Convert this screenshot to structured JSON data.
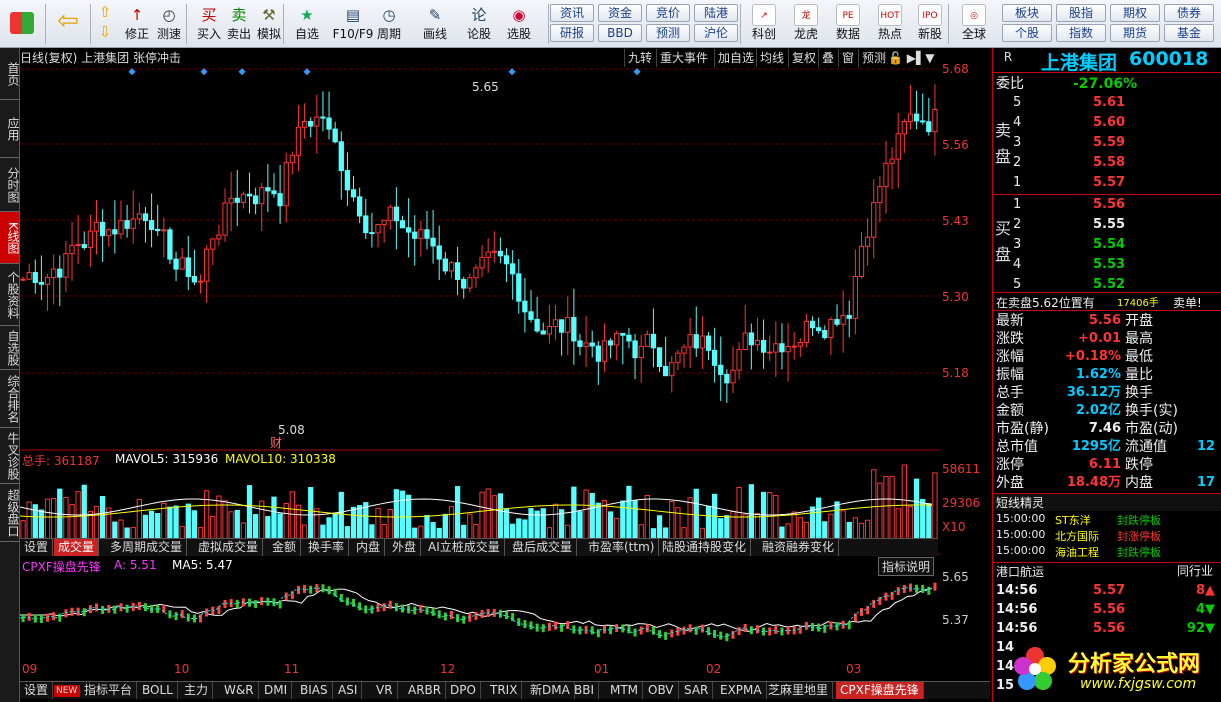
{
  "toolbar": {
    "row_buttons": [
      {
        "label": "修正",
        "icon": "↑"
      },
      {
        "label": "测速",
        "icon": "◴"
      },
      {
        "label": "买入",
        "icon": "买"
      },
      {
        "label": "卖出",
        "icon": "卖"
      },
      {
        "label": "模拟",
        "icon": "⚒"
      },
      {
        "label": "自选",
        "icon": "★"
      },
      {
        "label": "F10/F9",
        "icon": "▤"
      },
      {
        "label": "周期",
        "icon": "◷"
      },
      {
        "label": "画线",
        "icon": "✎"
      },
      {
        "label": "论股",
        "icon": "论"
      },
      {
        "label": "选股",
        "icon": "◉"
      }
    ],
    "grid1": [
      "资讯",
      "资金",
      "竞价",
      "陆港",
      "研报",
      "BBD",
      "预测",
      "沪伦"
    ],
    "mid_buttons": [
      {
        "label": "科创",
        "icon": "↗"
      },
      {
        "label": "龙虎",
        "icon": "龙"
      },
      {
        "label": "数据",
        "icon": "PE"
      },
      {
        "label": "热点",
        "icon": "HOT"
      },
      {
        "label": "新股",
        "icon": "IPO"
      },
      {
        "label": "全球",
        "icon": "◎"
      }
    ],
    "grid2": [
      "板块",
      "股指",
      "期权",
      "债券",
      "个股",
      "指数",
      "期货",
      "基金"
    ]
  },
  "leftnav": [
    {
      "label": "首页"
    },
    {
      "label": "应用"
    },
    {
      "label": "分时图"
    },
    {
      "label": "K线图",
      "active": true
    },
    {
      "label": "个股资料"
    },
    {
      "label": "自选股"
    },
    {
      "label": "综合排名"
    },
    {
      "label": "牛叉诊股"
    },
    {
      "label": "超级盘口"
    }
  ],
  "chart_title": "日线(复权) 上港集团 张停冲击",
  "chart_tabs": [
    "九转",
    "重大事件",
    "加自选",
    "均线",
    "复权",
    "叠",
    "窗",
    "预测"
  ],
  "chart_data": [
    {
      "type": "candlestick",
      "name": "price",
      "ylim": [
        5.05,
        5.68
      ],
      "y_ticks": [
        "5.68",
        "5.56",
        "5.43",
        "5.30",
        "5.18"
      ],
      "annotations": {
        "high": "5.65",
        "low": "5.08",
        "mark": "财"
      },
      "x_ticks": [
        "09",
        "10",
        "11",
        "12",
        "01",
        "02",
        "03"
      ]
    },
    {
      "type": "bar",
      "name": "volume",
      "legend": [
        {
          "label": "总手: 361187",
          "color": "#e33"
        },
        {
          "label": "MAVOL5: 315936",
          "color": "#fff"
        },
        {
          "label": "MAVOL10: 310338",
          "color": "#ff0"
        }
      ],
      "y_ticks": [
        "58611",
        "29306",
        "X10"
      ]
    },
    {
      "type": "line",
      "name": "indicator",
      "legend": [
        {
          "label": "CPXF操盘先锋",
          "color": "#f3f"
        },
        {
          "label": "A: 5.51",
          "color": "#f3f"
        },
        {
          "label": "MA5: 5.47",
          "color": "#fff"
        }
      ],
      "y_ticks": [
        "5.65",
        "5.37"
      ],
      "button": "指标说明"
    }
  ],
  "vol_tabs": [
    "设置",
    "成交量",
    "多周期成交量",
    "虚拟成交量",
    "金额",
    "换手率",
    "内盘",
    "外盘",
    "AI立桩成交量",
    "盘后成交量",
    "市盈率(ttm)",
    "陆股通持股变化",
    "融资融券变化"
  ],
  "bottom_tabs": [
    "设置",
    "NEW",
    "指标平台",
    "BOLL",
    "主力",
    "W&R",
    "DMI",
    "BIAS",
    "ASI",
    "VR",
    "ARBR",
    "DPO",
    "TRIX",
    "新DMA",
    "BBI",
    "MTM",
    "OBV",
    "SAR",
    "EXPMA",
    "芝麻里地里",
    "CPXF操盘先锋"
  ],
  "right": {
    "flag": "R",
    "name": "上港集团",
    "code": "600018",
    "weibi_label": "委比",
    "weibi": "-27.06%",
    "sell_label": "卖盘",
    "buy_label": "买盘",
    "sells": [
      {
        "n": "5",
        "p": "5.61"
      },
      {
        "n": "4",
        "p": "5.60"
      },
      {
        "n": "3",
        "p": "5.59"
      },
      {
        "n": "2",
        "p": "5.58"
      },
      {
        "n": "1",
        "p": "5.57"
      }
    ],
    "buys": [
      {
        "n": "1",
        "p": "5.56"
      },
      {
        "n": "2",
        "p": "5.55"
      },
      {
        "n": "3",
        "p": "5.54"
      },
      {
        "n": "4",
        "p": "5.53"
      },
      {
        "n": "5",
        "p": "5.52"
      }
    ],
    "notice1": "在卖盘5.62位置有",
    "notice2": "17406手",
    "notice3": "卖单!",
    "stats": [
      {
        "k": "最新",
        "v": "5.56",
        "k2": "开盘"
      },
      {
        "k": "涨跌",
        "v": "+0.01",
        "k2": "最高"
      },
      {
        "k": "涨幅",
        "v": "+0.18%",
        "k2": "最低"
      },
      {
        "k": "振幅",
        "v": "1.62%",
        "k2": "量比"
      },
      {
        "k": "总手",
        "v": "36.12万",
        "k2": "换手"
      },
      {
        "k": "金额",
        "v": "2.02亿",
        "k2": "换手(实)"
      },
      {
        "k": "市盈(静)",
        "v": "7.46",
        "k2": "市盈(动)"
      },
      {
        "k": "总市值",
        "v": "1295亿",
        "k2": "流通值",
        "v2": "12"
      },
      {
        "k": "涨停",
        "v": "6.11",
        "k2": "跌停"
      },
      {
        "k": "外盘",
        "v": "18.48万",
        "k2": "内盘",
        "v2": "17"
      }
    ],
    "short_title": "短线精灵",
    "short": [
      {
        "t": "15:00:00",
        "n": "ST东洋",
        "e": "封跌停板"
      },
      {
        "t": "15:00:00",
        "n": "北方国际",
        "e": "封涨停板"
      },
      {
        "t": "15:00:00",
        "n": "海油工程",
        "e": "封跌停板"
      }
    ],
    "sector_title": "港口航运",
    "sector_right": "同行业",
    "ticks": [
      {
        "t": "14:56",
        "p": "5.57",
        "v": "8",
        "d": "up"
      },
      {
        "t": "14:56",
        "p": "5.56",
        "v": "4",
        "d": "down"
      },
      {
        "t": "14:56",
        "p": "5.56",
        "v": "92",
        "d": "down"
      },
      {
        "t": "14"
      },
      {
        "t": "14"
      },
      {
        "t": "15"
      }
    ]
  },
  "watermark": {
    "cn": "分析家公式网",
    "url": "www.fxjgsw.com"
  }
}
